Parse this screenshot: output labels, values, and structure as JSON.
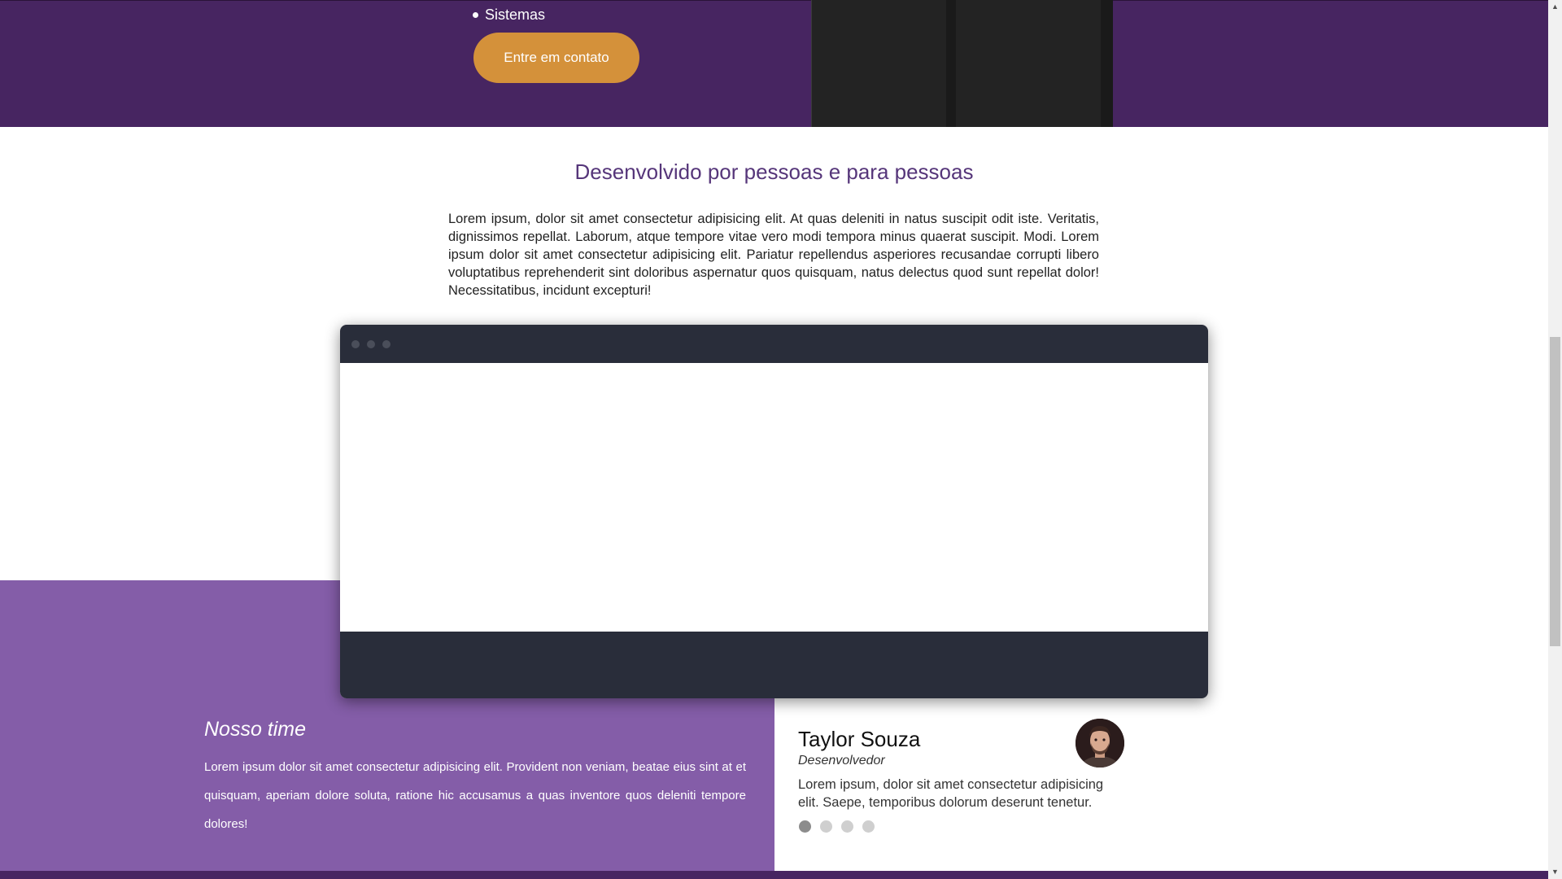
{
  "hero": {
    "list_items": [
      "Sistemas"
    ],
    "cta_label": "Entre em contato"
  },
  "about": {
    "title": "Desenvolvido por pessoas e para pessoas",
    "text": "Lorem ipsum, dolor sit amet consectetur adipisicing elit. At quas deleniti in natus suscipit odit iste. Veritatis, dignissimos repellat. Laborum, atque tempore vitae vero modi tempora minus quaerat suscipit. Modi. Lorem ipsum dolor sit amet consectetur adipisicing elit. Pariatur repellendus asperiores recusandae corrupti libero voluptatibus reprehenderit sint doloribus aspernatur quos quisquam, natus delectus quod sunt repellat dolor! Necessitatibus, incidunt excepturi!"
  },
  "team": {
    "title": "Nosso time",
    "text": "Lorem ipsum dolor sit amet consectetur adipisicing elit. Provident non veniam, beatae eius sint at et quisquam, aperiam dolore soluta, ratione hic accusamus a quas inventore quos deleniti tempore dolores!"
  },
  "testimonial": {
    "name": "Taylor Souza",
    "role": "Desenvolvedor",
    "quote": "Lorem ipsum, dolor sit amet consectetur adipisicing elit. Saepe, temporibus dolorum deserunt tenetur.",
    "active_slide": 1,
    "slide_count": 4
  },
  "colors": {
    "primary_purple": "#472561",
    "light_purple": "#845da8",
    "cta_orange": "#d4913a",
    "mock_dark": "#292d3a"
  },
  "icons": {
    "list_bullet": "bullet-icon",
    "avatar": "avatar-image",
    "scroll_up": "chevron-up-icon",
    "scroll_down": "chevron-down-icon"
  }
}
